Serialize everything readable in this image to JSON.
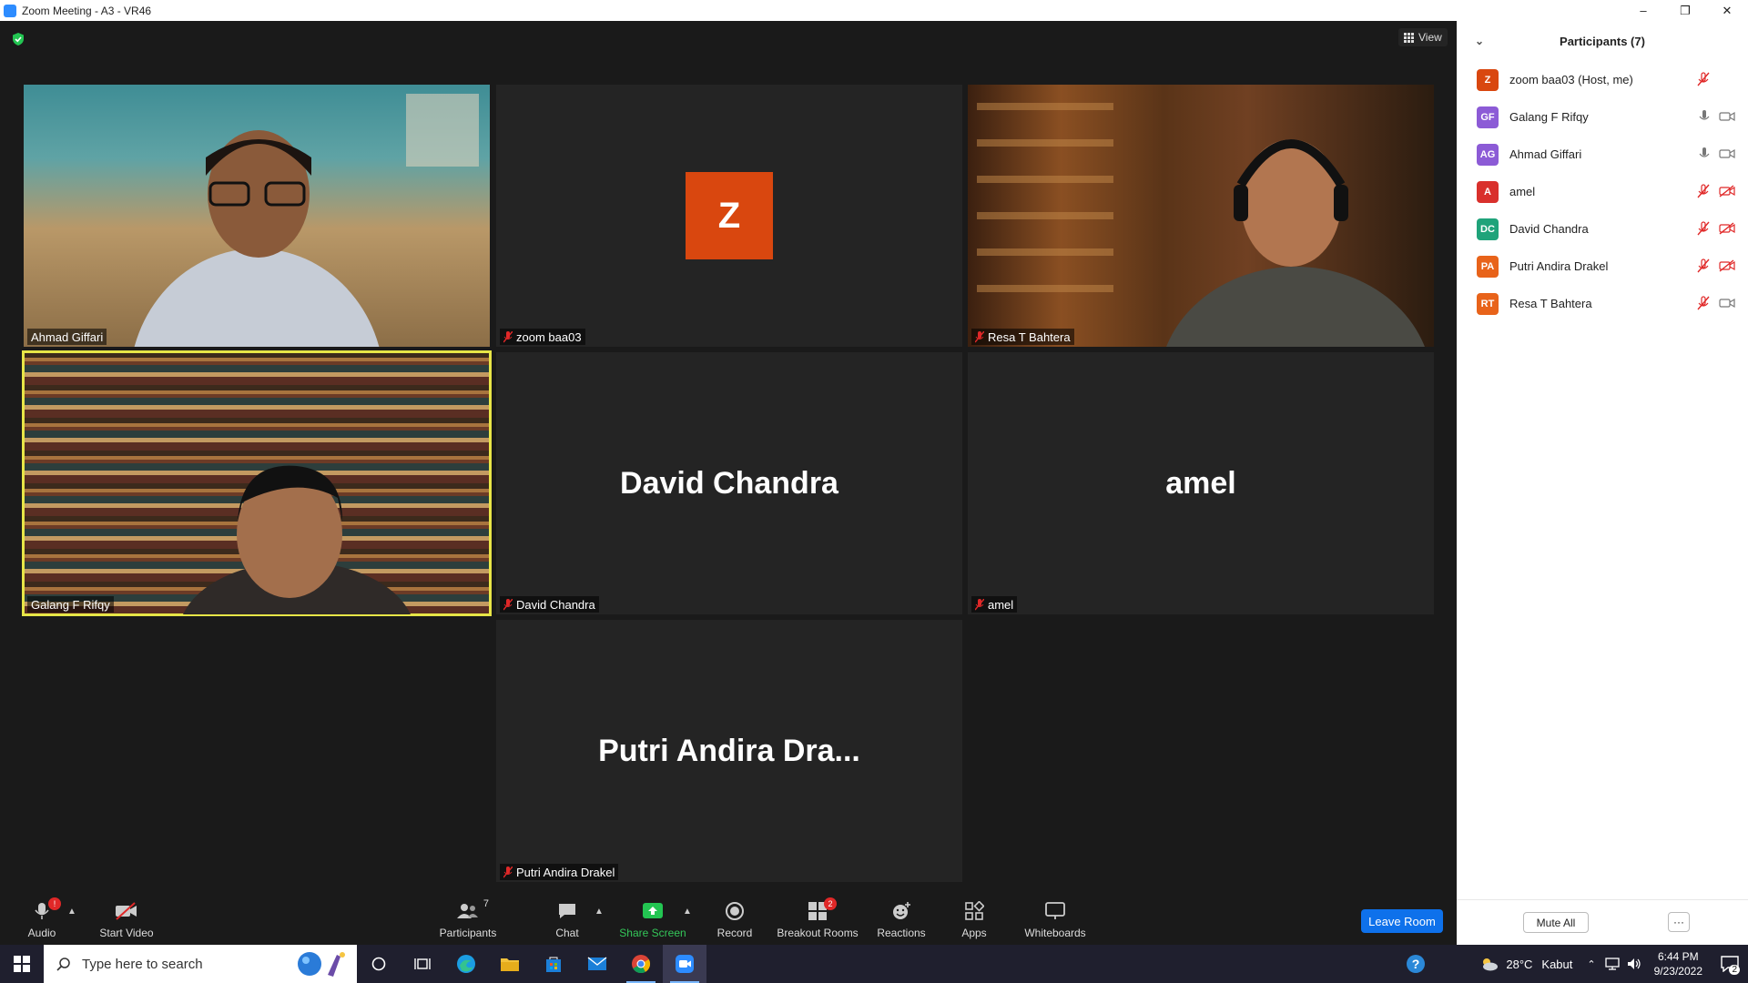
{
  "window": {
    "title": "Zoom Meeting - A3 - VR46"
  },
  "view_button": {
    "label": "View"
  },
  "tiles": [
    {
      "name": "Ahmad Giffari",
      "muted": false
    },
    {
      "name": "zoom baa03",
      "muted": true,
      "avatar_letter": "Z"
    },
    {
      "name": "Resa T Bahtera",
      "muted": true
    },
    {
      "name": "Galang F Rifqy",
      "muted": false,
      "active_speaker": true
    },
    {
      "name": "David Chandra",
      "muted": true,
      "display_name": "David Chandra"
    },
    {
      "name": "amel",
      "muted": true,
      "display_name": "amel"
    },
    {
      "name": "Putri Andira Drakel",
      "muted": true,
      "display_name": "Putri Andira Dra..."
    }
  ],
  "toolbar": {
    "audio": "Audio",
    "audio_badge": "!",
    "start_video": "Start Video",
    "participants": "Participants",
    "participants_count": "7",
    "chat": "Chat",
    "share_screen": "Share Screen",
    "record": "Record",
    "breakout_rooms": "Breakout Rooms",
    "breakout_badge": "2",
    "reactions": "Reactions",
    "apps": "Apps",
    "whiteboards": "Whiteboards",
    "leave_room": "Leave Room"
  },
  "participants_panel": {
    "title": "Participants (7)",
    "items": [
      {
        "initials": "Z",
        "name": "zoom baa03 (Host, me)",
        "color": "#d9470f",
        "mic": "muted-red",
        "video": "none"
      },
      {
        "initials": "GF",
        "name": "Galang F Rifqy",
        "color": "#8c5bd6",
        "mic": "on",
        "video": "on"
      },
      {
        "initials": "AG",
        "name": "Ahmad Giffari",
        "color": "#8c5bd6",
        "mic": "on",
        "video": "on"
      },
      {
        "initials": "A",
        "name": "amel",
        "color": "#d9302c",
        "mic": "muted-red",
        "video": "off-red"
      },
      {
        "initials": "DC",
        "name": "David Chandra",
        "color": "#1fa37a",
        "mic": "muted-red",
        "video": "off-red"
      },
      {
        "initials": "PA",
        "name": "Putri Andira Drakel",
        "color": "#e8631a",
        "mic": "muted-red",
        "video": "off-red"
      },
      {
        "initials": "RT",
        "name": "Resa T Bahtera",
        "color": "#e8631a",
        "mic": "muted-red",
        "video": "on"
      }
    ],
    "mute_all": "Mute All",
    "more": "···"
  },
  "taskbar": {
    "search_placeholder": "Type here to search",
    "weather_temp": "28°C",
    "weather_text": "Kabut",
    "time": "6:44 PM",
    "date": "9/23/2022",
    "notification_count": "2"
  },
  "colors": {
    "accent": "#0e71eb",
    "active_speaker": "#e7e547",
    "mute_red": "#e02828",
    "share_green": "#34c759"
  }
}
